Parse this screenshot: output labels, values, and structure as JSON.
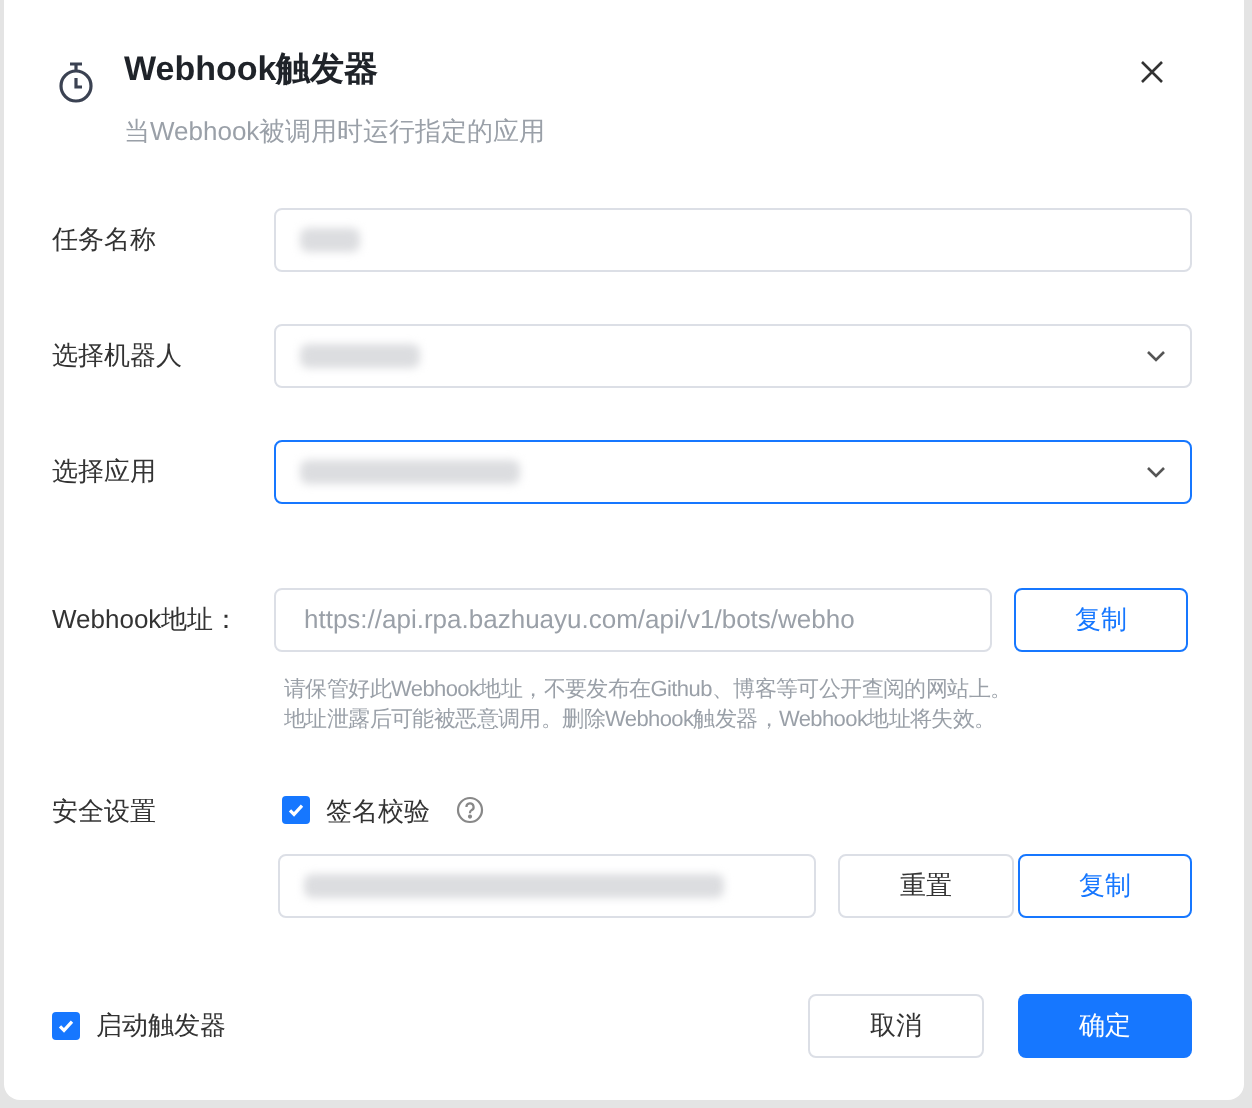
{
  "dialog": {
    "title": "Webhook触发器",
    "subtitle": "当Webhook被调用时运行指定的应用"
  },
  "fields": [
    {
      "label": "任务名称",
      "kind": "text",
      "focused": false
    },
    {
      "label": "选择机器人",
      "kind": "select",
      "focused": false
    },
    {
      "label": "选择应用",
      "kind": "select",
      "focused": true
    }
  ],
  "webhook": {
    "label": "Webhook地址：",
    "value": "https://api.rpa.bazhuayu.com/api/v1/bots/webho",
    "copy_button": "复制",
    "hint_lines": [
      "请保管好此Webhook地址，不要发布在Github、博客等可公开查阅的网站上。",
      "地址泄露后可能被恶意调用。删除Webhook触发器，Webhook地址将失效。"
    ]
  },
  "security": {
    "label": "安全设置",
    "signature_check": {
      "label": "签名校验",
      "checked": true
    },
    "reset_button": "重置",
    "copy_button": "复制"
  },
  "footer": {
    "enable_trigger": {
      "label": "启动触发器",
      "checked": true
    },
    "cancel_button": "取消",
    "confirm_button": "确定"
  }
}
